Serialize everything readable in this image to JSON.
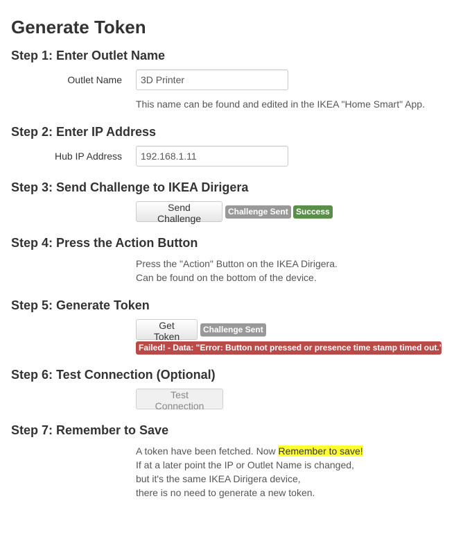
{
  "page": {
    "title": "Generate Token"
  },
  "step1": {
    "heading": "Step 1: Enter Outlet Name",
    "label": "Outlet Name",
    "value": "3D Printer",
    "help": "This name can be found and edited in the IKEA \"Home Smart\" App."
  },
  "step2": {
    "heading": "Step 2: Enter IP Address",
    "label": "Hub IP Address",
    "value": "192.168.1.11"
  },
  "step3": {
    "heading": "Step 3: Send Challenge to IKEA Dirigera",
    "button": "Send Challenge",
    "badges": [
      {
        "text": "Challenge Sent",
        "color": "#999999"
      },
      {
        "text": "Success",
        "color": "#5a8f4a"
      }
    ]
  },
  "step4": {
    "heading": "Step 4: Press the Action Button",
    "lines": [
      "Press the \"Action\" Button on the IKEA Dirigera.",
      "Can be found on the bottom of the device."
    ]
  },
  "step5": {
    "heading": "Step 5: Generate Token",
    "button": "Get Token",
    "badge": {
      "text": "Challenge Sent",
      "color": "#999999"
    },
    "error": {
      "text": "Failed! - Data: \"Error: Button not pressed or presence time stamp timed out.\"",
      "color": "#b94a48"
    }
  },
  "step6": {
    "heading": "Step 6: Test Connection (Optional)",
    "button": "Test Connection",
    "button_state": "disabled"
  },
  "step7": {
    "heading": "Step 7: Remember to Save",
    "line1_prefix": "A token have been fetched. Now ",
    "line1_highlight": "Remember to save!",
    "highlight_color": "#ffff33",
    "lines": [
      "If at a later point the IP or Outlet Name is changed,",
      "but it's the same IKEA Dirigera device,",
      "there is no need to generate a new token."
    ]
  }
}
